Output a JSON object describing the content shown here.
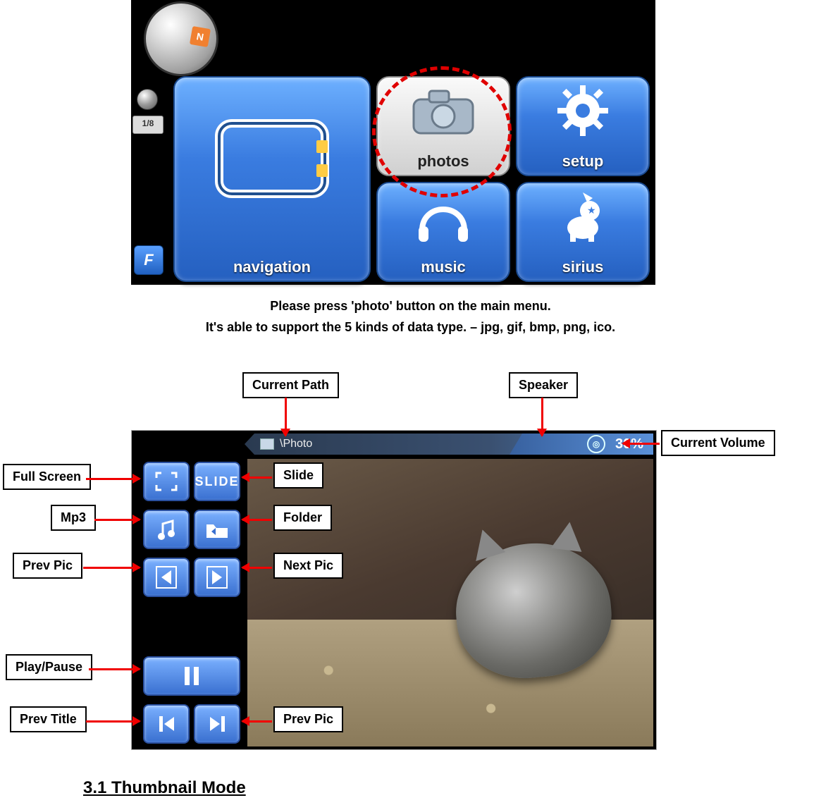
{
  "screenshot_main": {
    "scale": "1/8",
    "f_badge": "F",
    "buttons": {
      "navigation": "navigation",
      "photos": "photos",
      "setup": "setup",
      "music": "music",
      "sirius": "sirius"
    }
  },
  "captions": {
    "line1": "Please press 'photo' button on the main menu.",
    "line2": "It's able to support the 5 kinds of data type. – jpg, gif, bmp, png, ico."
  },
  "screenshot_viewer": {
    "current_path": "\\Photo",
    "volume_text": "30%",
    "slide_label": "SLIDE"
  },
  "callouts": {
    "current_path": "Current Path",
    "speaker": "Speaker",
    "current_volume": "Current Volume",
    "full_screen": "Full Screen",
    "slide": "Slide",
    "mp3": "Mp3",
    "folder": "Folder",
    "prev_pic": "Prev Pic",
    "next_pic": "Next Pic",
    "play_pause": "Play/Pause",
    "prev_title": "Prev Title",
    "prev_pic2": "Prev Pic"
  },
  "section_heading": "3.1 Thumbnail Mode"
}
